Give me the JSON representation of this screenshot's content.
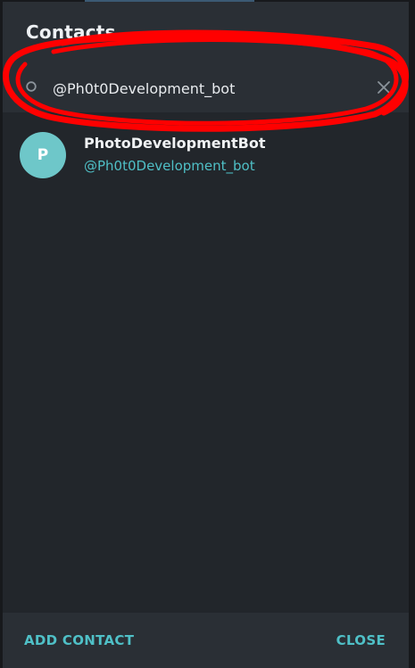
{
  "dialog": {
    "title": "Contacts"
  },
  "search": {
    "icon": "search-icon",
    "value": "@Ph0t0Development_bot",
    "clear_icon": "close-icon"
  },
  "results": [
    {
      "avatar_initial": "P",
      "avatar_color": "#6ec7c9",
      "name": "PhotoDevelopmentBot",
      "username": "@Ph0t0Development_bot"
    }
  ],
  "footer": {
    "add_label": "ADD CONTACT",
    "close_label": "CLOSE"
  },
  "colors": {
    "accent": "#4fbfc6",
    "dialog_bg": "#22262b",
    "header_bg": "#2a2f35",
    "annotation": "#ff0000"
  }
}
